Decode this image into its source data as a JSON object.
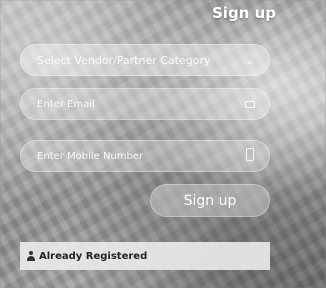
{
  "form": {
    "title": "Sign up",
    "category_select": {
      "value": "Select Vendor/Partner Category"
    },
    "email": {
      "placeholder": "Enter Email"
    },
    "mobile": {
      "placeholder": "Enter Mobile Number"
    },
    "submit_label": "Sign up",
    "already_registered": "Already Registered"
  },
  "icons": {
    "select": "chevron-down-icon",
    "email": "envelope-icon",
    "mobile": "phone-icon",
    "registered": "user-icon"
  }
}
